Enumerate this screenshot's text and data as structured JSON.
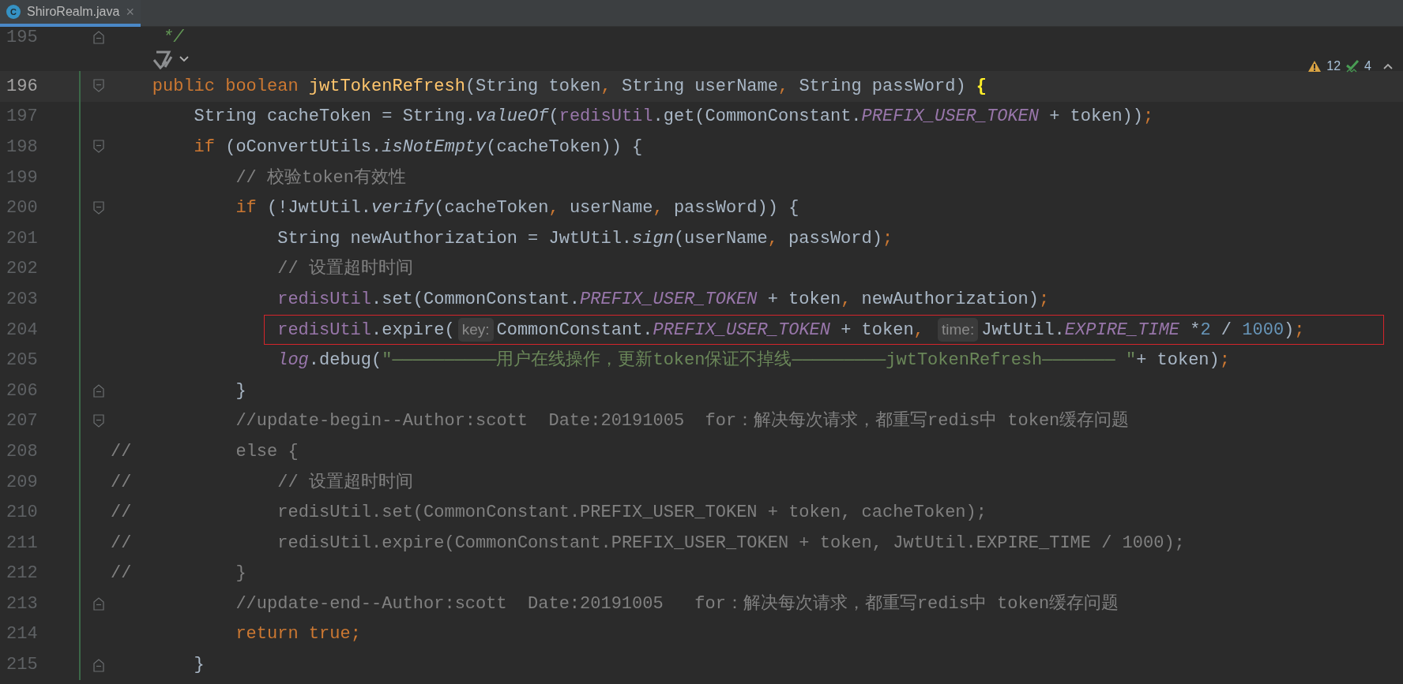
{
  "tab": {
    "icon_letter": "C",
    "label": "ShiroRealm.java",
    "close": "×",
    "selected": true
  },
  "inspections": {
    "warnings": "12",
    "weak_warnings": "4"
  },
  "lines": [
    {
      "number": "195",
      "fold_start": false,
      "fold_end": true,
      "current": false,
      "changed": false,
      "code_vision": false,
      "boxed": false,
      "segments": [
        {
          "kind": "code",
          "tokens": [
            {
              "kind": "doc",
              "text": "     */"
            }
          ]
        }
      ]
    },
    {
      "number": "196",
      "fold_start": true,
      "fold_end": false,
      "current": true,
      "changed": true,
      "code_vision": true,
      "boxed": false,
      "segments": [
        {
          "kind": "code",
          "tokens": [
            {
              "kind": "keyword",
              "text": "    public boolean "
            },
            {
              "kind": "declaration",
              "text": "jwtTokenRefresh"
            },
            {
              "kind": "plain",
              "text": "(String token"
            },
            {
              "kind": "punctuation",
              "text": ", "
            },
            {
              "kind": "plain",
              "text": "String userName"
            },
            {
              "kind": "punctuation",
              "text": ", "
            },
            {
              "kind": "plain",
              "text": "String passWord) "
            },
            {
              "kind": "brace",
              "text": "{"
            }
          ]
        }
      ]
    },
    {
      "number": "197",
      "fold_start": false,
      "fold_end": false,
      "current": false,
      "changed": true,
      "code_vision": false,
      "boxed": false,
      "segments": [
        {
          "kind": "code",
          "tokens": [
            {
              "kind": "plain",
              "text": "        String cacheToken = String."
            },
            {
              "kind": "italic",
              "text": "valueOf"
            },
            {
              "kind": "plain",
              "text": "("
            },
            {
              "kind": "field",
              "text": "redisUtil"
            },
            {
              "kind": "plain",
              "text": ".get(CommonConstant."
            },
            {
              "kind": "static",
              "text": "PREFIX_USER_TOKEN"
            },
            {
              "kind": "plain",
              "text": " + token))"
            },
            {
              "kind": "punctuation",
              "text": ";"
            }
          ]
        }
      ]
    },
    {
      "number": "198",
      "fold_start": true,
      "fold_end": false,
      "current": false,
      "changed": true,
      "code_vision": false,
      "boxed": false,
      "segments": [
        {
          "kind": "code",
          "tokens": [
            {
              "kind": "keyword",
              "text": "        if "
            },
            {
              "kind": "plain",
              "text": "(oConvertUtils."
            },
            {
              "kind": "italic",
              "text": "isNotEmpty"
            },
            {
              "kind": "plain",
              "text": "(cacheToken)) {"
            }
          ]
        }
      ]
    },
    {
      "number": "199",
      "fold_start": false,
      "fold_end": false,
      "current": false,
      "changed": true,
      "code_vision": false,
      "boxed": false,
      "segments": [
        {
          "kind": "code",
          "tokens": [
            {
              "kind": "comment",
              "text": "            // 校验token有效性"
            }
          ]
        }
      ]
    },
    {
      "number": "200",
      "fold_start": true,
      "fold_end": false,
      "current": false,
      "changed": true,
      "code_vision": false,
      "boxed": false,
      "segments": [
        {
          "kind": "code",
          "tokens": [
            {
              "kind": "keyword",
              "text": "            if "
            },
            {
              "kind": "plain",
              "text": "(!JwtUtil."
            },
            {
              "kind": "italic",
              "text": "verify"
            },
            {
              "kind": "plain",
              "text": "(cacheToken"
            },
            {
              "kind": "punctuation",
              "text": ", "
            },
            {
              "kind": "plain",
              "text": "userName"
            },
            {
              "kind": "punctuation",
              "text": ", "
            },
            {
              "kind": "plain",
              "text": "passWord)) {"
            }
          ]
        }
      ]
    },
    {
      "number": "201",
      "fold_start": false,
      "fold_end": false,
      "current": false,
      "changed": true,
      "code_vision": false,
      "boxed": false,
      "segments": [
        {
          "kind": "code",
          "tokens": [
            {
              "kind": "plain",
              "text": "                String newAuthorization = JwtUtil."
            },
            {
              "kind": "italic",
              "text": "sign"
            },
            {
              "kind": "plain",
              "text": "(userName"
            },
            {
              "kind": "punctuation",
              "text": ", "
            },
            {
              "kind": "plain",
              "text": "passWord)"
            },
            {
              "kind": "punctuation",
              "text": ";"
            }
          ]
        }
      ]
    },
    {
      "number": "202",
      "fold_start": false,
      "fold_end": false,
      "current": false,
      "changed": true,
      "code_vision": false,
      "boxed": false,
      "segments": [
        {
          "kind": "code",
          "tokens": [
            {
              "kind": "comment",
              "text": "                // 设置超时时间"
            }
          ]
        }
      ]
    },
    {
      "number": "203",
      "fold_start": false,
      "fold_end": false,
      "current": false,
      "changed": true,
      "code_vision": false,
      "boxed": false,
      "segments": [
        {
          "kind": "code",
          "tokens": [
            {
              "kind": "field",
              "text": "                redisUtil"
            },
            {
              "kind": "plain",
              "text": ".set(CommonConstant."
            },
            {
              "kind": "static",
              "text": "PREFIX_USER_TOKEN"
            },
            {
              "kind": "plain",
              "text": " + token"
            },
            {
              "kind": "punctuation",
              "text": ", "
            },
            {
              "kind": "plain",
              "text": "newAuthorization)"
            },
            {
              "kind": "punctuation",
              "text": ";"
            }
          ]
        }
      ]
    },
    {
      "number": "204",
      "fold_start": false,
      "fold_end": false,
      "current": false,
      "changed": true,
      "code_vision": false,
      "boxed": true,
      "segments": [
        {
          "kind": "code",
          "tokens": [
            {
              "kind": "field",
              "text": "                redisUtil"
            },
            {
              "kind": "plain",
              "text": ".expire("
            }
          ]
        },
        {
          "kind": "hint",
          "text": "key:"
        },
        {
          "kind": "code",
          "tokens": [
            {
              "kind": "plain",
              "text": "CommonConstant."
            },
            {
              "kind": "static",
              "text": "PREFIX_USER_TOKEN"
            },
            {
              "kind": "plain",
              "text": " + token"
            },
            {
              "kind": "punctuation",
              "text": ", "
            }
          ]
        },
        {
          "kind": "hint",
          "text": "time:"
        },
        {
          "kind": "code",
          "tokens": [
            {
              "kind": "plain",
              "text": "JwtUtil."
            },
            {
              "kind": "static",
              "text": "EXPIRE_TIME"
            },
            {
              "kind": "plain",
              "text": " *"
            },
            {
              "kind": "number",
              "text": "2"
            },
            {
              "kind": "plain",
              "text": " / "
            },
            {
              "kind": "number",
              "text": "1000"
            },
            {
              "kind": "plain",
              "text": ")"
            },
            {
              "kind": "punctuation",
              "text": ";"
            }
          ]
        }
      ]
    },
    {
      "number": "205",
      "fold_start": false,
      "fold_end": false,
      "current": false,
      "changed": true,
      "code_vision": false,
      "boxed": false,
      "segments": [
        {
          "kind": "code",
          "tokens": [
            {
              "kind": "static",
              "text": "                log"
            },
            {
              "kind": "plain",
              "text": ".debug("
            },
            {
              "kind": "string",
              "text": "\"——————————用户在线操作，更新token保证不掉线—————————jwtTokenRefresh——————— \""
            },
            {
              "kind": "plain",
              "text": "+ token)"
            },
            {
              "kind": "punctuation",
              "text": ";"
            }
          ]
        }
      ]
    },
    {
      "number": "206",
      "fold_start": false,
      "fold_end": true,
      "current": false,
      "changed": true,
      "code_vision": false,
      "boxed": false,
      "segments": [
        {
          "kind": "code",
          "tokens": [
            {
              "kind": "plain",
              "text": "            }"
            }
          ]
        }
      ]
    },
    {
      "number": "207",
      "fold_start": true,
      "fold_end": false,
      "current": false,
      "changed": true,
      "code_vision": false,
      "boxed": false,
      "segments": [
        {
          "kind": "code",
          "tokens": [
            {
              "kind": "comment",
              "text": "            //update-begin--Author:scott  Date:20191005  for：解决每次请求，都重写redis中 token缓存问题"
            }
          ]
        }
      ]
    },
    {
      "number": "208",
      "fold_start": false,
      "fold_end": false,
      "current": false,
      "changed": true,
      "code_vision": false,
      "boxed": false,
      "segments": [
        {
          "kind": "code",
          "tokens": [
            {
              "kind": "comment",
              "text": "//          else {"
            }
          ]
        }
      ]
    },
    {
      "number": "209",
      "fold_start": false,
      "fold_end": false,
      "current": false,
      "changed": true,
      "code_vision": false,
      "boxed": false,
      "segments": [
        {
          "kind": "code",
          "tokens": [
            {
              "kind": "comment",
              "text": "//              // 设置超时时间"
            }
          ]
        }
      ]
    },
    {
      "number": "210",
      "fold_start": false,
      "fold_end": false,
      "current": false,
      "changed": true,
      "code_vision": false,
      "boxed": false,
      "segments": [
        {
          "kind": "code",
          "tokens": [
            {
              "kind": "comment",
              "text": "//              redisUtil.set(CommonConstant.PREFIX_USER_TOKEN + token, cacheToken);"
            }
          ]
        }
      ]
    },
    {
      "number": "211",
      "fold_start": false,
      "fold_end": false,
      "current": false,
      "changed": true,
      "code_vision": false,
      "boxed": false,
      "segments": [
        {
          "kind": "code",
          "tokens": [
            {
              "kind": "comment",
              "text": "//              redisUtil.expire(CommonConstant.PREFIX_USER_TOKEN + token, JwtUtil.EXPIRE_TIME / 1000);"
            }
          ]
        }
      ]
    },
    {
      "number": "212",
      "fold_start": false,
      "fold_end": false,
      "current": false,
      "changed": true,
      "code_vision": false,
      "boxed": false,
      "segments": [
        {
          "kind": "code",
          "tokens": [
            {
              "kind": "comment",
              "text": "//          }"
            }
          ]
        }
      ]
    },
    {
      "number": "213",
      "fold_start": false,
      "fold_end": true,
      "current": false,
      "changed": true,
      "code_vision": false,
      "boxed": false,
      "segments": [
        {
          "kind": "code",
          "tokens": [
            {
              "kind": "comment",
              "text": "            //update-end--Author:scott  Date:20191005   for：解决每次请求，都重写redis中 token缓存问题"
            }
          ]
        }
      ]
    },
    {
      "number": "214",
      "fold_start": false,
      "fold_end": false,
      "current": false,
      "changed": true,
      "code_vision": false,
      "boxed": false,
      "segments": [
        {
          "kind": "code",
          "tokens": [
            {
              "kind": "keyword",
              "text": "            return true"
            },
            {
              "kind": "punctuation",
              "text": ";"
            }
          ]
        }
      ]
    },
    {
      "number": "215",
      "fold_start": false,
      "fold_end": true,
      "current": false,
      "changed": true,
      "code_vision": false,
      "boxed": false,
      "segments": [
        {
          "kind": "code",
          "tokens": [
            {
              "kind": "plain",
              "text": "        }"
            }
          ]
        }
      ]
    }
  ]
}
